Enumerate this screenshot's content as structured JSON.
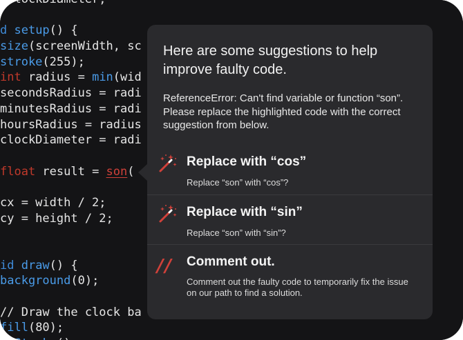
{
  "editor": {
    "lines": [
      {
        "parts": [
          {
            "t": "eclockDiameter;",
            "c": ""
          }
        ]
      },
      {
        "parts": []
      },
      {
        "parts": [
          {
            "t": "d ",
            "c": "kw"
          },
          {
            "t": "setup",
            "c": "fn"
          },
          {
            "t": "() {",
            "c": ""
          }
        ]
      },
      {
        "parts": [
          {
            "t": "size",
            "c": "fn"
          },
          {
            "t": "(screenWidth, sc",
            "c": ""
          }
        ]
      },
      {
        "parts": [
          {
            "t": "stroke",
            "c": "fn"
          },
          {
            "t": "(255);",
            "c": ""
          }
        ]
      },
      {
        "parts": [
          {
            "t": "int",
            "c": "ty"
          },
          {
            "t": " radius = ",
            "c": ""
          },
          {
            "t": "min",
            "c": "fn"
          },
          {
            "t": "(wid",
            "c": ""
          }
        ]
      },
      {
        "parts": [
          {
            "t": "secondsRadius = radi",
            "c": ""
          }
        ]
      },
      {
        "parts": [
          {
            "t": "minutesRadius = radi",
            "c": ""
          }
        ]
      },
      {
        "parts": [
          {
            "t": "hoursRadius = radius",
            "c": ""
          }
        ]
      },
      {
        "parts": [
          {
            "t": "clockDiameter = radi",
            "c": ""
          }
        ]
      },
      {
        "parts": []
      },
      {
        "parts": [
          {
            "t": "float",
            "c": "ty"
          },
          {
            "t": " result = ",
            "c": ""
          },
          {
            "t": "son",
            "c": "err"
          },
          {
            "t": "(",
            "c": ""
          }
        ]
      },
      {
        "parts": []
      },
      {
        "parts": [
          {
            "t": "cx = width / 2;",
            "c": ""
          }
        ]
      },
      {
        "parts": [
          {
            "t": "cy = height / 2;",
            "c": ""
          }
        ]
      },
      {
        "parts": []
      },
      {
        "parts": []
      },
      {
        "parts": [
          {
            "t": "id ",
            "c": "kw"
          },
          {
            "t": "draw",
            "c": "fn"
          },
          {
            "t": "() {",
            "c": ""
          }
        ]
      },
      {
        "parts": [
          {
            "t": "background",
            "c": "fn"
          },
          {
            "t": "(0);",
            "c": ""
          }
        ]
      },
      {
        "parts": []
      },
      {
        "parts": [
          {
            "t": "// Draw the clock ba",
            "c": ""
          }
        ]
      },
      {
        "parts": [
          {
            "t": "fill",
            "c": "fn"
          },
          {
            "t": "(80);",
            "c": ""
          }
        ]
      },
      {
        "parts": [
          {
            "t": "noStroke",
            "c": "fn"
          },
          {
            "t": "();",
            "c": ""
          }
        ]
      }
    ]
  },
  "popover": {
    "title": "Here are some suggestions to help improve faulty code.",
    "description": "ReferenceError: Can't find variable or function “son”. Please replace the highlighted code with the correct suggestion from below.",
    "suggestions": [
      {
        "icon": "magic-wand-icon",
        "title": "Replace with “cos”",
        "subtitle": "Replace “son” with “cos”?"
      },
      {
        "icon": "magic-wand-icon",
        "title": "Replace with “sin”",
        "subtitle": "Replace “son” with “sin”?"
      },
      {
        "icon": "comment-slashes-icon",
        "icon_text": "//",
        "title": "Comment out.",
        "subtitle": "Comment out the faulty code to temporarily fix the issue on our path to find a solution."
      }
    ]
  },
  "colors": {
    "accent_red": "#d0413a",
    "keyword_blue": "#3f8bd8",
    "popover_bg": "#2a2a2d",
    "editor_bg": "#141416"
  }
}
